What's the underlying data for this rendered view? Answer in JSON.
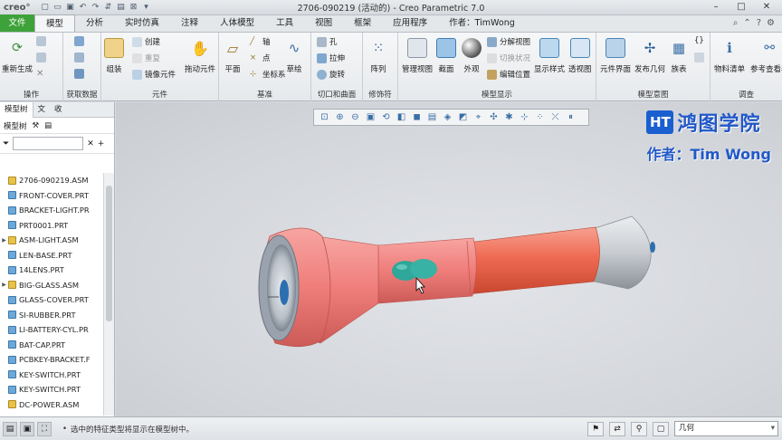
{
  "title_bar": {
    "logo": "creo°",
    "title": "2706-090219 (活动的) - Creo Parametric 7.0"
  },
  "tabs": [
    {
      "label": "文件"
    },
    {
      "label": "模型"
    },
    {
      "label": "分析"
    },
    {
      "label": "实时仿真"
    },
    {
      "label": "注释"
    },
    {
      "label": "人体模型"
    },
    {
      "label": "工具"
    },
    {
      "label": "视图"
    },
    {
      "label": "框架"
    },
    {
      "label": "应用程序"
    },
    {
      "label": "作者：TimWong"
    }
  ],
  "ribbon": {
    "ops": {
      "label": "操作",
      "regen": "重新生成"
    },
    "getdata": {
      "label": "获取数据"
    },
    "component": {
      "label": "元件",
      "assemble": "组装",
      "create": "创建",
      "repeat": "重复",
      "mirror": "镜像元件",
      "drag": "拖动元件"
    },
    "datum": {
      "label": "基准",
      "plane": "平面",
      "axis": "轴",
      "point": "点",
      "csys": "坐标系",
      "sketch": "草绘"
    },
    "cut": {
      "label": "切口和曲面",
      "hole": "孔",
      "extrude": "拉伸",
      "revolve": "旋转"
    },
    "modifiers": {
      "label": "修饰符",
      "pattern": "阵列"
    },
    "display": {
      "label": "模型显示",
      "manage_views": "管理视图",
      "section": "截面",
      "appearance": "外观",
      "explode_view": "分解视图",
      "explode_state": "切换状况",
      "edit_pos": "编辑位置",
      "display_style": "显示样式",
      "perspective": "透视图"
    },
    "intent": {
      "label": "模型意图",
      "comp_interface": "元件界面",
      "publish_geom": "发布几何",
      "family_table": "族表",
      "relations": "{}"
    },
    "investigate": {
      "label": "调查",
      "bom": "物料清单",
      "ref_viewer": "参考查看器"
    }
  },
  "left_panel": {
    "tabs": [
      {
        "label": "模型树"
      },
      {
        "label": "文"
      },
      {
        "label": "收"
      }
    ],
    "tree_label": "模型树",
    "tree": [
      {
        "name": "2706-090219.ASM",
        "type": "asm"
      },
      {
        "name": "FRONT-COVER.PRT",
        "type": "prt"
      },
      {
        "name": "BRACKET-LIGHT.PR",
        "type": "prt"
      },
      {
        "name": "PRT0001.PRT",
        "type": "prt"
      },
      {
        "name": "ASM-LIGHT.ASM",
        "type": "asm"
      },
      {
        "name": "LEN-BASE.PRT",
        "type": "prt"
      },
      {
        "name": "14LENS.PRT",
        "type": "prt"
      },
      {
        "name": "BIG-GLASS.ASM",
        "type": "asm"
      },
      {
        "name": "GLASS-COVER.PRT",
        "type": "prt"
      },
      {
        "name": "SI-RUBBER.PRT",
        "type": "prt"
      },
      {
        "name": "LI-BATTERY-CYL.PR",
        "type": "prt"
      },
      {
        "name": "BAT-CAP.PRT",
        "type": "prt"
      },
      {
        "name": "PCBKEY-BRACKET.F",
        "type": "prt"
      },
      {
        "name": "KEY-SWITCH.PRT",
        "type": "prt"
      },
      {
        "name": "KEY-SWITCH.PRT",
        "type": "prt"
      },
      {
        "name": "DC-POWER.ASM",
        "type": "asm"
      }
    ]
  },
  "watermark": {
    "badge": "HT",
    "name": "鸿图学院",
    "author": "作者：Tim Wong"
  },
  "status": {
    "message": "选中的特征类型将显示在模型树中。",
    "filter_value": "几何"
  },
  "colors": {
    "file_tab": "#3ea23a",
    "flashlight_head": "#ef7d7a",
    "flashlight_body": "#ef6a52",
    "flashlight_cap": "#c8ccd1",
    "switch": "#2fa79a"
  }
}
